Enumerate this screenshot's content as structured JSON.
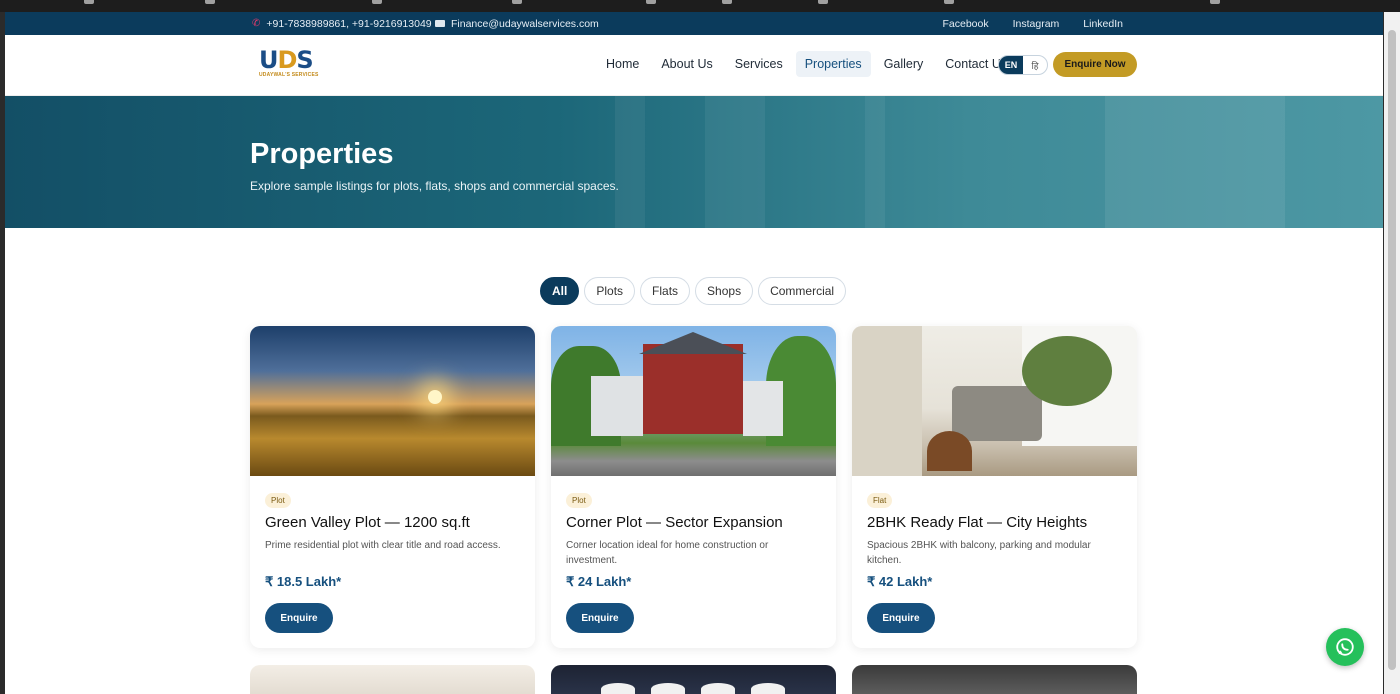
{
  "topbar": {
    "phone": "+91-7838989861, +91-9216913049",
    "email": "Finance@udaywalservices.com",
    "social": [
      "Facebook",
      "Instagram",
      "LinkedIn"
    ]
  },
  "brand": {
    "logo_text": "UDS",
    "tagline": "UDAYWAL'S SERVICES"
  },
  "nav": {
    "items": [
      "Home",
      "About Us",
      "Services",
      "Properties",
      "Gallery",
      "Contact Us"
    ],
    "active": "Properties",
    "lang_en": "EN",
    "lang_hi": "हि",
    "cta": "Enquire Now"
  },
  "hero": {
    "title": "Properties",
    "subtitle": "Explore sample listings for plots, flats, shops and commercial spaces."
  },
  "filters": [
    "All",
    "Plots",
    "Flats",
    "Shops",
    "Commercial"
  ],
  "active_filter": "All",
  "listings": [
    {
      "tag": "Plot",
      "title": "Green Valley Plot — 1200 sq.ft",
      "desc": "Prime residential plot with clear title and road access.",
      "price": "₹ 18.5 Lakh*",
      "button": "Enquire"
    },
    {
      "tag": "Plot",
      "title": "Corner Plot — Sector Expansion",
      "desc": "Corner location ideal for home construction or investment.",
      "price": "₹ 24 Lakh*",
      "button": "Enquire"
    },
    {
      "tag": "Flat",
      "title": "2BHK Ready Flat — City Heights",
      "desc": "Spacious 2BHK with balcony, parking and modular kitchen.",
      "price": "₹ 42 Lakh*",
      "button": "Enquire"
    }
  ],
  "colors": {
    "primary": "#0b3b5c",
    "accent": "#c39b25",
    "price": "#16507e",
    "whatsapp": "#25c05b"
  }
}
